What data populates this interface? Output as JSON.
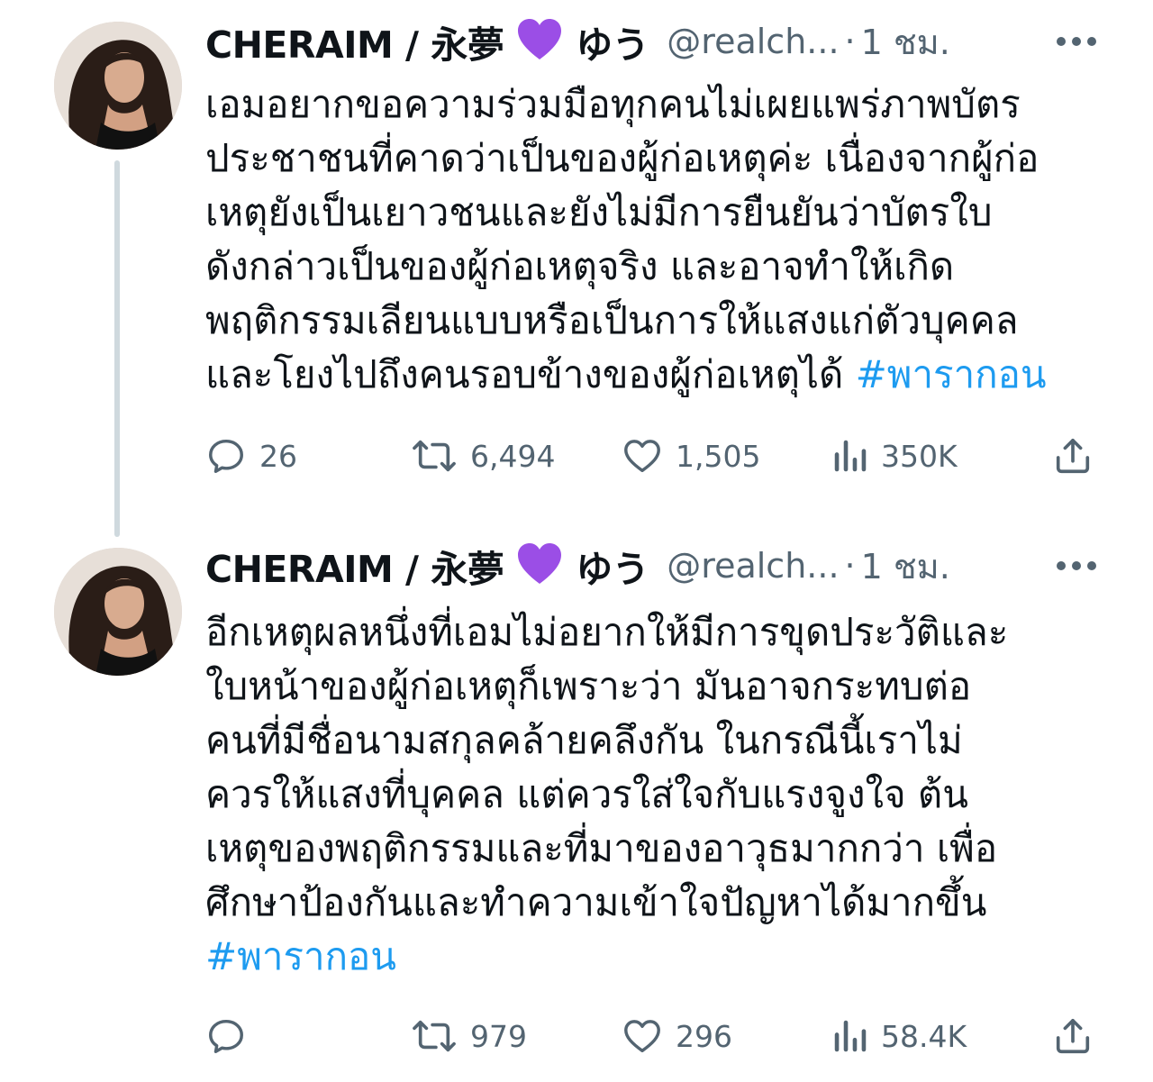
{
  "tweets": [
    {
      "author": {
        "name_prefix": "CHERAIM / 永夢",
        "name_suffix": "ゆう",
        "handle": "@realch...",
        "separator": "·",
        "time": "1 ชม."
      },
      "text_lines": [
        "เอมอยากขอความร่วมมือทุกคนไม่เผยแพร่ภาพบัตร",
        "ประชาชนที่คาดว่าเป็นของผู้ก่อเหตุค่ะ เนื่องจากผู้ก่อ",
        "เหตุยังเป็นเยาวชนและยังไม่มีการยืนยันว่าบัตรใบ",
        "ดังกล่าวเป็นของผู้ก่อเหตุจริง และอาจทำให้เกิด",
        "พฤติกรรมเลียนแบบหรือเป็นการให้แสงแก่ตัวบุคคล",
        "และโยงไปถึงคนรอบข้างของผู้ก่อเหตุได้ "
      ],
      "hashtag": "#พารากอน",
      "stats": {
        "replies": "26",
        "retweets": "6,494",
        "likes": "1,505",
        "views": "350K"
      }
    },
    {
      "author": {
        "name_prefix": "CHERAIM / 永夢",
        "name_suffix": "ゆう",
        "handle": "@realch...",
        "separator": "·",
        "time": "1 ชม."
      },
      "text_lines": [
        "อีกเหตุผลหนึ่งที่เอมไม่อยากให้มีการขุดประวัติและ",
        "ใบหน้าของผู้ก่อเหตุก็เพราะว่า มันอาจกระทบต่อ",
        "คนที่มีชื่อนามสกุลคล้ายคลึงกัน ในกรณีนี้เราไม่",
        "ควรให้แสงที่บุคคล แต่ควรใส่ใจกับแรงจูงใจ ต้น",
        "เหตุของพฤติกรรมและที่มาของอาวุธมากกว่า เพื่อ",
        "ศึกษาป้องกันและทำความเข้าใจปัญหาได้มากขึ้น"
      ],
      "hashtag": "#พารากอน",
      "stats": {
        "replies": "",
        "retweets": "979",
        "likes": "296",
        "views": "58.4K"
      }
    }
  ],
  "icons": {
    "avatar": "avatar-photo",
    "emoji": "purple-heart-icon",
    "more": "more-dots-icon",
    "reply": "reply-icon",
    "retweet": "retweet-icon",
    "like": "heart-icon",
    "views": "views-icon",
    "share": "share-icon"
  },
  "colors": {
    "text": "#0f1419",
    "secondary": "#536471",
    "hashtag": "#1d9bf0",
    "thread_line": "#cfd9de",
    "emoji": "#9b4ee6"
  }
}
